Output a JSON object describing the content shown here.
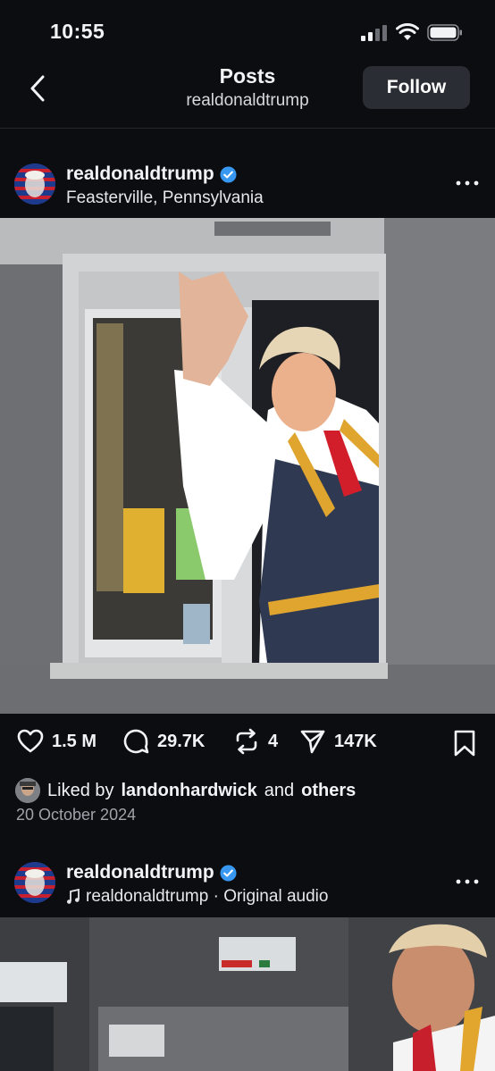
{
  "status_bar": {
    "time": "10:55"
  },
  "header": {
    "title": "Posts",
    "subtitle": "realdonaldtrump",
    "follow_label": "Follow"
  },
  "post1": {
    "username": "realdonaldtrump",
    "location": "Feasterville, Pennsylvania",
    "likes": "1.5 M",
    "comments": "29.7K",
    "reposts": "4",
    "shares": "147K",
    "liked_by_prefix": "Liked by",
    "liked_by_user": "landonhardwick",
    "liked_by_joiner": "and",
    "liked_by_others": "others",
    "date": "20 October 2024"
  },
  "post2": {
    "username": "realdonaldtrump",
    "audio": "realdonaldtrump · Original audio"
  },
  "colors": {
    "background": "#0c0d11",
    "verified": "#3897f0",
    "follow_bg": "#2a2d33",
    "secondary_text": "#a0a3aa"
  },
  "icons": [
    "back-chevron-icon",
    "signal-icon",
    "wifi-icon",
    "battery-icon",
    "verified-badge-icon",
    "more-icon",
    "heart-icon",
    "comment-icon",
    "repost-icon",
    "share-icon",
    "bookmark-icon",
    "music-note-icon"
  ]
}
